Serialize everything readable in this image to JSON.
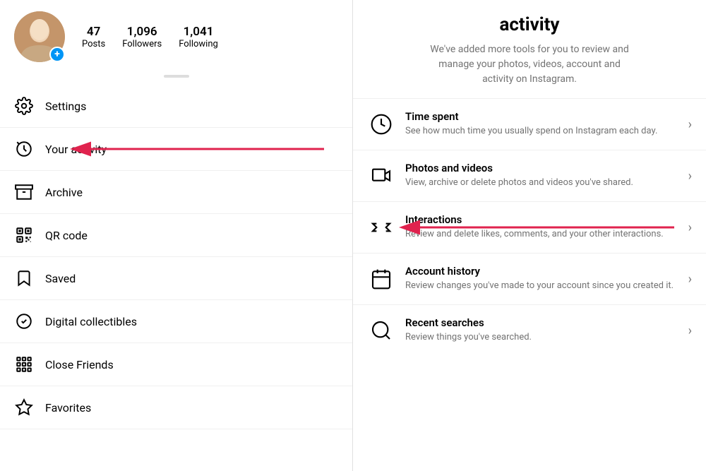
{
  "profile": {
    "posts_count": "47",
    "posts_label": "Posts",
    "followers_count": "1,096",
    "followers_label": "Followers",
    "following_count": "1,041",
    "following_label": "Following",
    "add_button": "+"
  },
  "menu": {
    "items": [
      {
        "id": "settings",
        "label": "Settings",
        "icon": "gear"
      },
      {
        "id": "your-activity",
        "label": "Your activity",
        "icon": "activity",
        "highlighted": true
      },
      {
        "id": "archive",
        "label": "Archive",
        "icon": "archive"
      },
      {
        "id": "qr-code",
        "label": "QR code",
        "icon": "qr"
      },
      {
        "id": "saved",
        "label": "Saved",
        "icon": "bookmark"
      },
      {
        "id": "digital-collectibles",
        "label": "Digital collectibles",
        "icon": "collectibles"
      },
      {
        "id": "close-friends",
        "label": "Close Friends",
        "icon": "close-friends"
      },
      {
        "id": "favorites",
        "label": "Favorites",
        "icon": "star"
      }
    ]
  },
  "right": {
    "title": "activity",
    "subtitle": "We've added more tools for you to review and manage your photos, videos, account and activity on Instagram.",
    "items": [
      {
        "id": "time-spent",
        "title": "Time spent",
        "desc": "See how much time you usually spend on Instagram each day.",
        "icon": "clock"
      },
      {
        "id": "photos-videos",
        "title": "Photos and videos",
        "desc": "View, archive or delete photos and videos you've shared.",
        "icon": "media"
      },
      {
        "id": "interactions",
        "title": "Interactions",
        "desc": "Review and delete likes, comments, and your other interactions.",
        "icon": "interactions",
        "annotated": true
      },
      {
        "id": "account-history",
        "title": "Account history",
        "desc": "Review changes you've made to your account since you created it.",
        "icon": "calendar"
      },
      {
        "id": "recent-searches",
        "title": "Recent searches",
        "desc": "Review things you've searched.",
        "icon": "search"
      }
    ]
  }
}
